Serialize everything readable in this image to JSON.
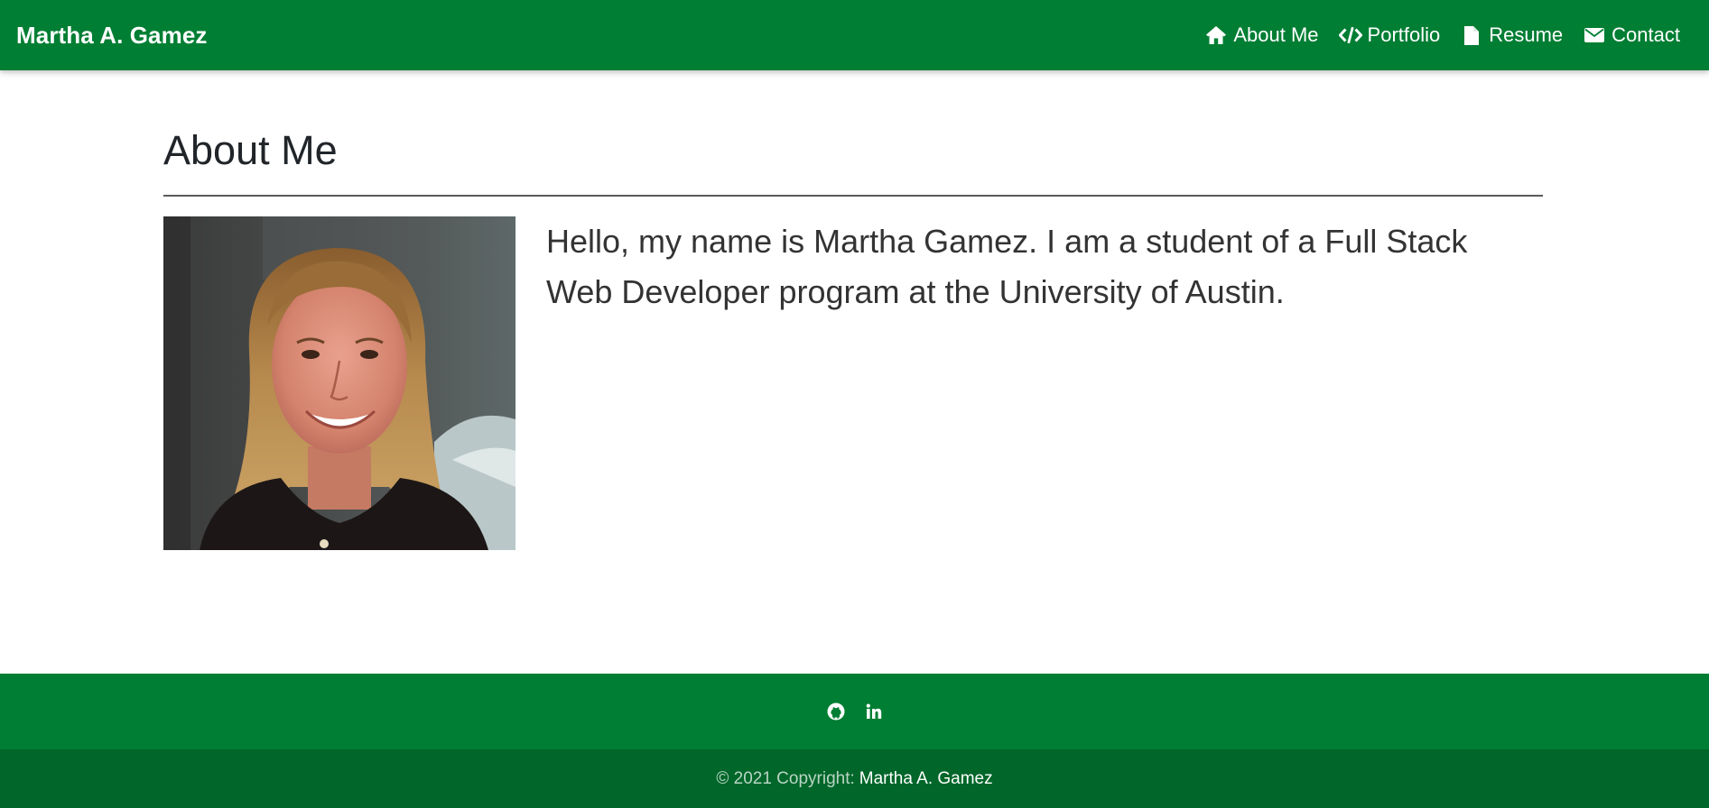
{
  "navbar": {
    "brand": "Martha A. Gamez",
    "links": [
      {
        "label": "About Me",
        "icon": "home-icon"
      },
      {
        "label": "Portfolio",
        "icon": "code-icon"
      },
      {
        "label": "Resume",
        "icon": "file-icon"
      },
      {
        "label": "Contact",
        "icon": "envelope-icon"
      }
    ]
  },
  "main": {
    "heading": "About Me",
    "bio": "Hello, my name is Martha Gamez. I am a student of a Full Stack Web Developer program at the University of Austin.",
    "photo": "portrait-photo"
  },
  "footer": {
    "social": [
      {
        "icon": "github-icon"
      },
      {
        "icon": "linkedin-icon"
      }
    ],
    "copyright_prefix": "© 2021 Copyright:",
    "copyright_name": "Martha A. Gamez"
  },
  "colors": {
    "nav_green": "#007e33",
    "footer_dark_green": "#006629",
    "text": "#212529"
  }
}
